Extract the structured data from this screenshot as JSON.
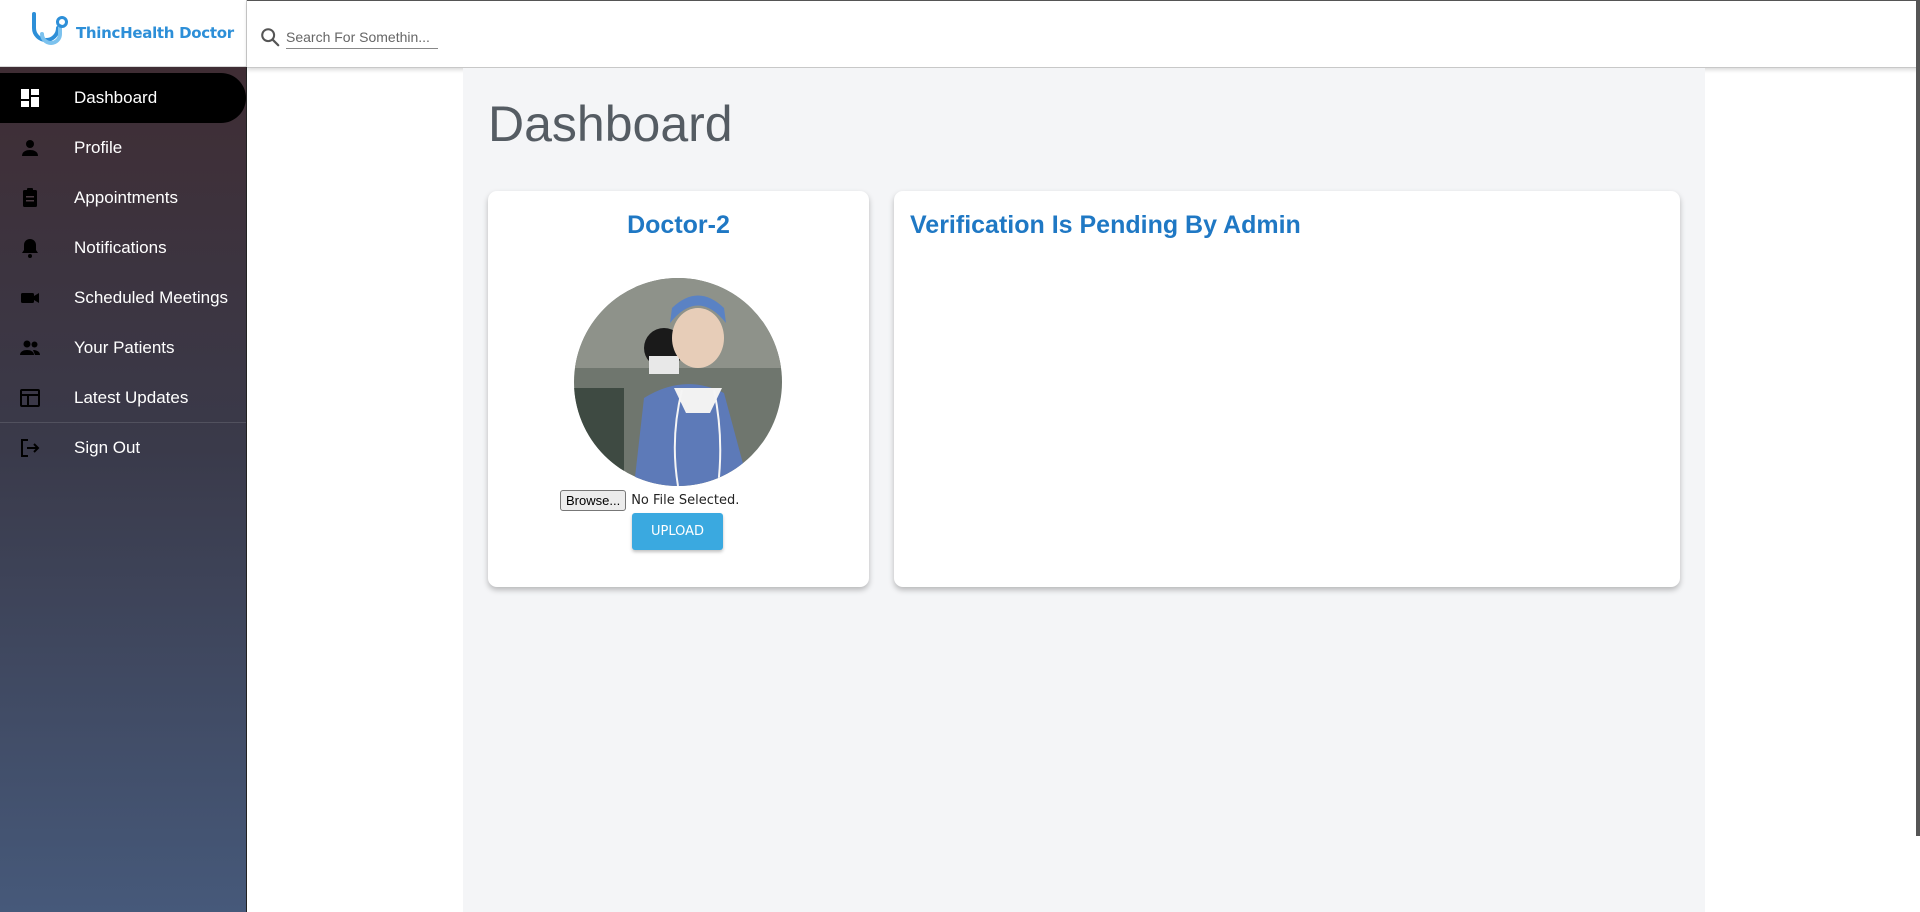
{
  "app": {
    "logo_text": "ThincHealth Doctor"
  },
  "search": {
    "placeholder": "Search For Somethin..."
  },
  "sidebar": {
    "items": [
      {
        "label": "Dashboard",
        "icon": "dashboard-icon",
        "active": true
      },
      {
        "label": "Profile",
        "icon": "person-icon"
      },
      {
        "label": "Appointments",
        "icon": "clipboard-icon"
      },
      {
        "label": "Notifications",
        "icon": "bell-icon"
      },
      {
        "label": "Scheduled Meetings",
        "icon": "video-camera-icon"
      },
      {
        "label": "Your Patients",
        "icon": "people-icon"
      },
      {
        "label": "Latest Updates",
        "icon": "table-icon"
      },
      {
        "label": "Sign Out",
        "icon": "logout-icon"
      }
    ]
  },
  "main": {
    "title": "Dashboard",
    "profile_card": {
      "name": "Doctor-2",
      "browse_label": "Browse...",
      "file_status": "No File Selected.",
      "upload_label": "UPLOAD"
    },
    "status_card": {
      "title": "Verification Is Pending By Admin"
    }
  },
  "colors": {
    "accent_blue": "#1f78c4",
    "upload_button": "#3aa9e0",
    "logo_blue": "#2d8fd8"
  }
}
